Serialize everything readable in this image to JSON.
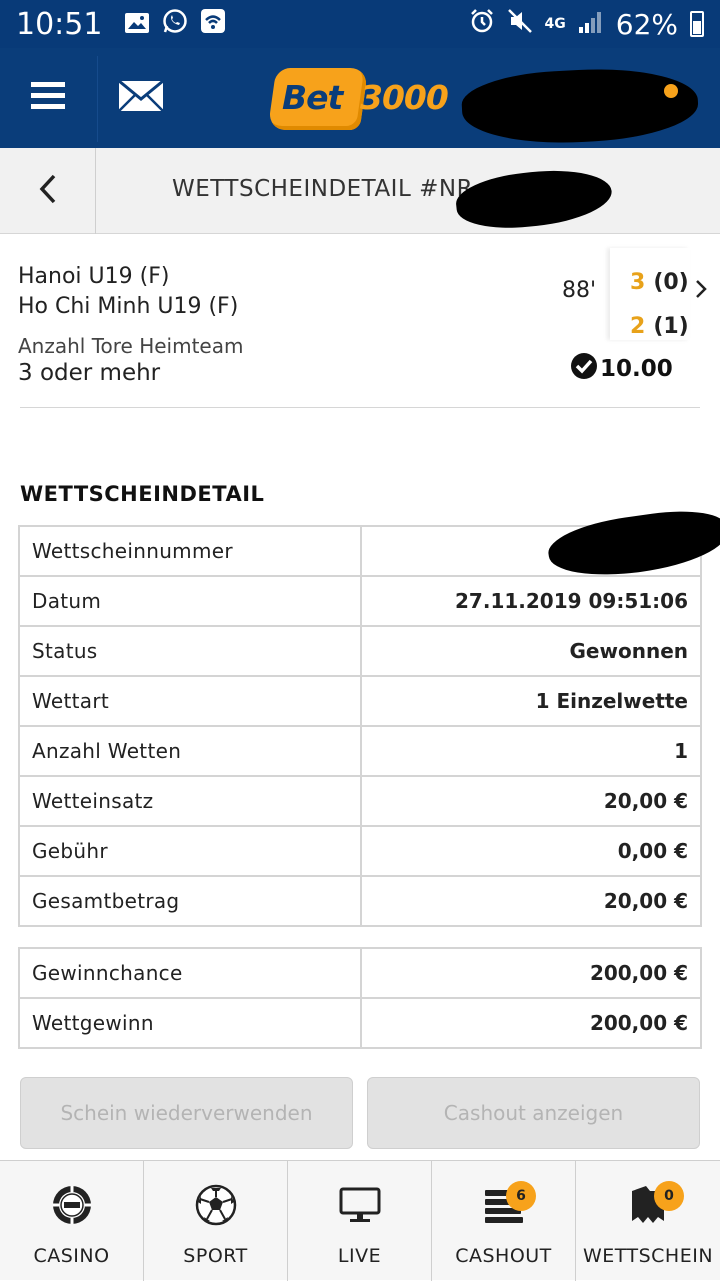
{
  "status_bar": {
    "time": "10:51",
    "network": "4G",
    "battery": "62%",
    "icons": [
      "image-icon",
      "whatsapp-icon",
      "wifi-calling-icon",
      "alarm-icon",
      "mute-icon",
      "signal-icon",
      "battery-icon"
    ]
  },
  "app_bar": {
    "logo_prefix": "Bet",
    "logo_suffix": "3000",
    "menu_icon": "menu-icon",
    "mail_icon": "mail-icon"
  },
  "sub_header": {
    "title": "WETTSCHEINDETAIL #NR. 2"
  },
  "match": {
    "home_team": "Hanoi U19 (F)",
    "away_team": "Ho Chi Minh U19 (F)",
    "minute": "88'",
    "home_score": "3",
    "home_half": "(0)",
    "away_score": "2",
    "away_half": "(1)",
    "market": "Anzahl Tore Heimteam",
    "pick": "3 oder mehr",
    "odds": "10.00"
  },
  "details": {
    "section_title": "WETTSCHEINDETAIL",
    "rows": [
      {
        "label": "Wettscheinnummer",
        "value": ""
      },
      {
        "label": "Datum",
        "value": "27.11.2019 09:51:06"
      },
      {
        "label": "Status",
        "value": "Gewonnen"
      },
      {
        "label": "Wettart",
        "value": "1 Einzelwette"
      },
      {
        "label": "Anzahl Wetten",
        "value": "1"
      },
      {
        "label": "Wetteinsatz",
        "value": "20,00 €"
      },
      {
        "label": "Gebühr",
        "value": "0,00 €"
      },
      {
        "label": "Gesamtbetrag",
        "value": "20,00 €"
      }
    ],
    "win_rows": [
      {
        "label": "Gewinnchance",
        "value": "200,00 €"
      },
      {
        "label": "Wettgewinn",
        "value": "200,00 €"
      }
    ]
  },
  "buttons": {
    "reuse": "Schein wiederverwenden",
    "cashout": "Cashout anzeigen"
  },
  "bottom_nav": [
    {
      "label": "CASINO",
      "icon": "casino-chip-icon"
    },
    {
      "label": "SPORT",
      "icon": "soccer-ball-icon"
    },
    {
      "label": "LIVE",
      "icon": "monitor-icon"
    },
    {
      "label": "CASHOUT",
      "icon": "cashout-stack-icon",
      "badge": "6"
    },
    {
      "label": "WETTSCHEIN",
      "icon": "betslip-icon",
      "badge": "0"
    }
  ],
  "colors": {
    "brand_blue": "#0a3d7a",
    "accent_orange": "#f7a21b"
  }
}
